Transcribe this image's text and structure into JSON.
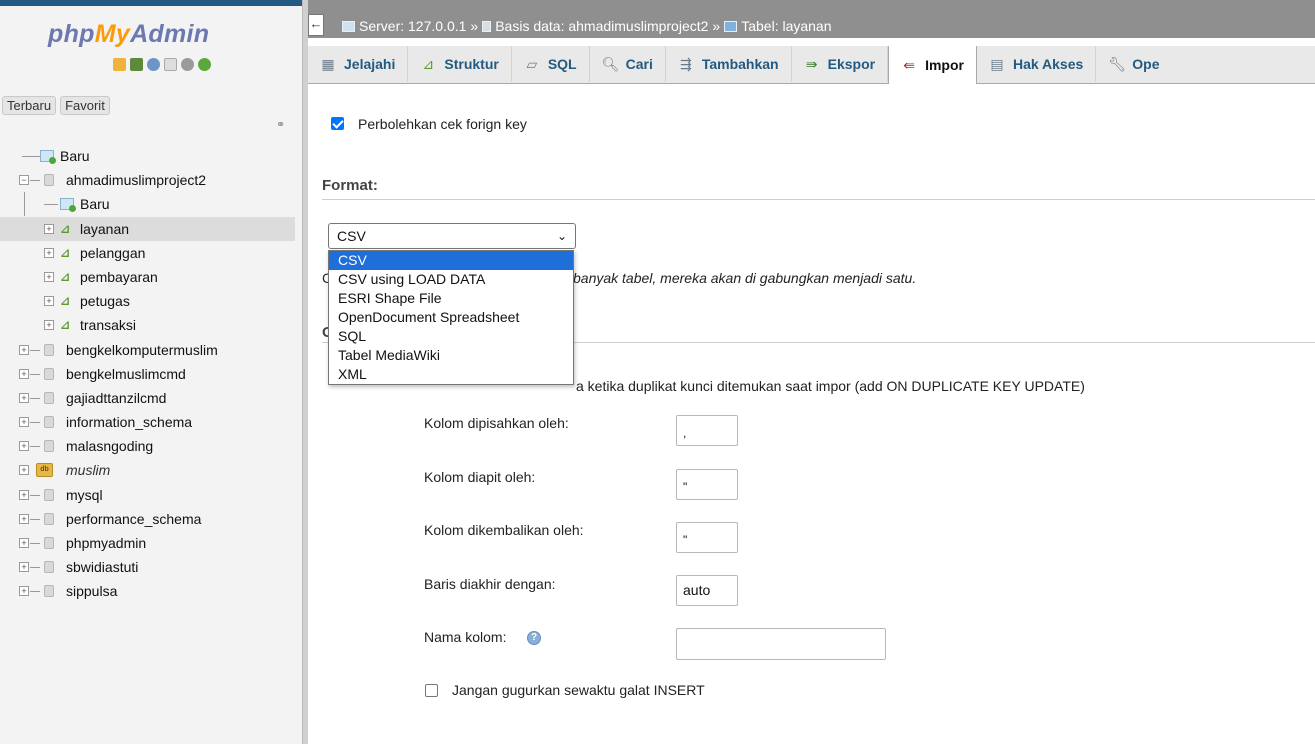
{
  "nav": {
    "logo": {
      "php": "php",
      "my": "My",
      "admin": "Admin"
    },
    "recent_label": "Terbaru",
    "favorite_label": "Favorit",
    "tree": {
      "new_root": "Baru",
      "current_db": "ahmadimuslimproject2",
      "current_db_new": "Baru",
      "tables": [
        "layanan",
        "pelanggan",
        "pembayaran",
        "petugas",
        "transaksi"
      ],
      "selected_table": "layanan",
      "databases": [
        "bengkelkomputermuslim",
        "bengkelmuslimcmd",
        "gajiadttanzilcmd",
        "information_schema",
        "malasngoding",
        "muslim",
        "mysql",
        "performance_schema",
        "phpmyadmin",
        "sbwidiastuti",
        "sippulsa"
      ]
    }
  },
  "breadcrumb": {
    "server": "Server: 127.0.0.1",
    "separator": "»",
    "database": "Basis data: ahmadimuslimproject2",
    "table": "Tabel: layanan"
  },
  "tabs": [
    {
      "label": "Jelajahi",
      "icon": "browse-icon"
    },
    {
      "label": "Struktur",
      "icon": "structure-icon"
    },
    {
      "label": "SQL",
      "icon": "sql-icon"
    },
    {
      "label": "Cari",
      "icon": "search-icon"
    },
    {
      "label": "Tambahkan",
      "icon": "insert-icon"
    },
    {
      "label": "Ekspor",
      "icon": "export-icon"
    },
    {
      "label": "Impor",
      "icon": "import-icon",
      "active": true
    },
    {
      "label": "Hak Akses",
      "icon": "privileges-icon"
    },
    {
      "label": "Ope",
      "icon": "operations-icon"
    }
  ],
  "main": {
    "foreign_key_check": {
      "label": "Perbolehkan cek forign key",
      "checked": true
    },
    "format": {
      "title": "Format:",
      "selected": "CSV",
      "options": [
        "CSV",
        "CSV using LOAD DATA",
        "ESRI Shape File",
        "OpenDocument Spreadsheet",
        "SQL",
        "Tabel MediaWiki",
        "XML"
      ],
      "hint_start": "C",
      "hint_visible": "banyak tabel, mereka akan di gabungkan menjadi satu."
    },
    "options_section_initial": "O",
    "duplicate_visible": "a ketika duplikat kunci ditemukan saat impor (add ON DUPLICATE KEY UPDATE)",
    "fields": {
      "separated_label": "Kolom dipisahkan oleh:",
      "separated_value": ",",
      "enclosed_label": "Kolom diapit oleh:",
      "enclosed_value": "\"",
      "escaped_label": "Kolom dikembalikan oleh:",
      "escaped_value": "\"",
      "lines_label": "Baris diakhir dengan:",
      "lines_value": "auto",
      "column_names_label": "Nama kolom:",
      "column_names_value": ""
    },
    "abort_on_error": {
      "label": "Jangan gugurkan sewaktu galat INSERT",
      "checked": false
    }
  }
}
